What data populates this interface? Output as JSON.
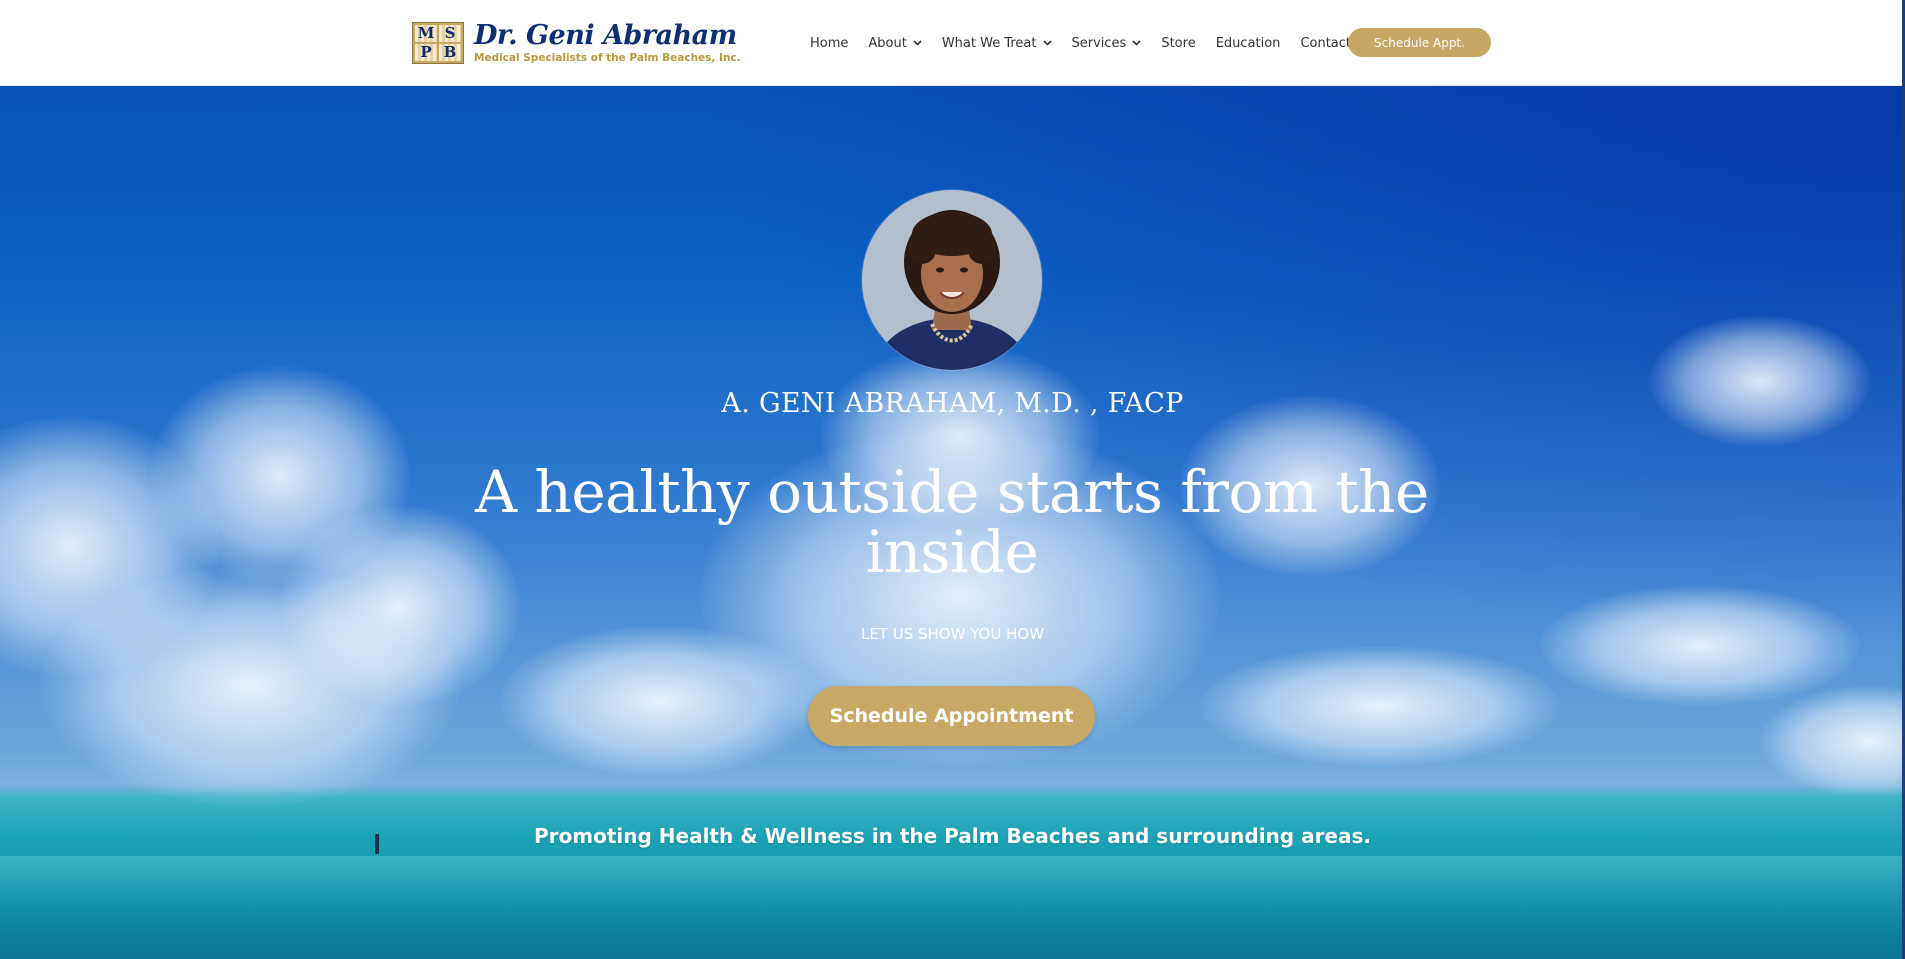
{
  "header": {
    "logo": {
      "mark_letters": [
        "M",
        "S",
        "P",
        "B"
      ],
      "title": "Dr. Geni Abraham",
      "subtitle": "Medical Specialists of the Palm Beaches, Inc."
    },
    "nav": [
      {
        "label": "Home",
        "has_dropdown": false
      },
      {
        "label": "About",
        "has_dropdown": true
      },
      {
        "label": "What We Treat",
        "has_dropdown": true
      },
      {
        "label": "Services",
        "has_dropdown": true
      },
      {
        "label": "Store",
        "has_dropdown": false
      },
      {
        "label": "Education",
        "has_dropdown": false
      },
      {
        "label": "Contact Us",
        "has_dropdown": false
      }
    ],
    "cta_label": "Schedule Appt."
  },
  "hero": {
    "doctor_name": "A. GENI ABRAHAM, M.D. , FACP",
    "headline": "A healthy outside starts from the inside",
    "subheadline": "LET US SHOW YOU HOW",
    "cta_label": "Schedule Appointment",
    "tagline": "Promoting Health & Wellness in the Palm Beaches and surrounding areas."
  },
  "colors": {
    "brand_navy": "#0d2f73",
    "brand_gold": "#c7a764",
    "sky_blue": "#0e62c4",
    "sea_teal": "#1da3b6"
  }
}
